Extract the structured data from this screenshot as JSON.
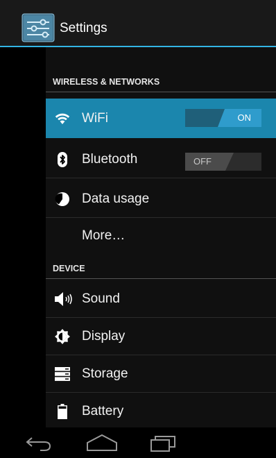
{
  "action_bar": {
    "title": "Settings",
    "icon": "settings-sliders-icon",
    "accent_color": "#33b5e5"
  },
  "sections": {
    "wireless": {
      "header": "WIRELESS & NETWORKS",
      "items": [
        {
          "label": "WiFi",
          "icon": "wifi-icon",
          "toggle": "ON",
          "selected": true
        },
        {
          "label": "Bluetooth",
          "icon": "bluetooth-icon",
          "toggle": "OFF"
        },
        {
          "label": "Data usage",
          "icon": "data-usage-icon"
        },
        {
          "label": "More…"
        }
      ]
    },
    "device": {
      "header": "DEVICE",
      "items": [
        {
          "label": "Sound",
          "icon": "sound-icon"
        },
        {
          "label": "Display",
          "icon": "display-icon"
        },
        {
          "label": "Storage",
          "icon": "storage-icon"
        },
        {
          "label": "Battery",
          "icon": "battery-icon"
        }
      ]
    }
  },
  "nav_bar": {
    "buttons": [
      "back-icon",
      "home-icon",
      "recent-apps-icon"
    ]
  },
  "colors": {
    "selected_row": "#1b86ad",
    "toggle_on": "#2f9ccc"
  }
}
